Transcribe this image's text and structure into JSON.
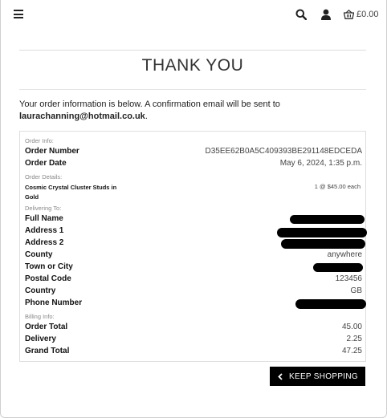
{
  "header": {
    "basket_total": "£0.00",
    "icons": [
      "menu-icon",
      "search-icon",
      "user-icon",
      "basket-icon"
    ]
  },
  "page": {
    "title": "THANK YOU",
    "intro_text": "Your order information is below. A confirmation email will be sent to",
    "email": "laurachanning@hotmail.co.uk",
    "email_suffix": "."
  },
  "order": {
    "order_info_heading": "Order Info:",
    "order_number_label": "Order Number",
    "order_number": "D35EE62B0A5C409393BE291148EDCEDA",
    "order_date_label": "Order Date",
    "order_date": "May 6, 2024, 1:35 p.m.",
    "order_details_heading": "Order Details:",
    "product_name": "Cosmic Crystal Cluster Studs in Gold",
    "product_qty_price": "1 @ $45.00 each",
    "delivering_heading": "Delivering To:",
    "full_name_label": "Full Name",
    "address1_label": "Address 1",
    "address2_label": "Address 2",
    "county_label": "County",
    "county": "anywhere",
    "town_label": "Town or City",
    "postal_label": "Postal Code",
    "postal_code": "123456",
    "country_label": "Country",
    "country": "GB",
    "phone_label": "Phone Number",
    "billing_heading": "Billing Info:",
    "order_total_label": "Order Total",
    "order_total": "45.00",
    "delivery_label": "Delivery",
    "delivery": "2.25",
    "grand_total_label": "Grand Total",
    "grand_total": "47.25"
  },
  "actions": {
    "keep_shopping": "KEEP SHOPPING"
  },
  "colors": {
    "button_bg": "#000000",
    "button_text": "#ffffff",
    "divider": "#dcdcdc"
  }
}
